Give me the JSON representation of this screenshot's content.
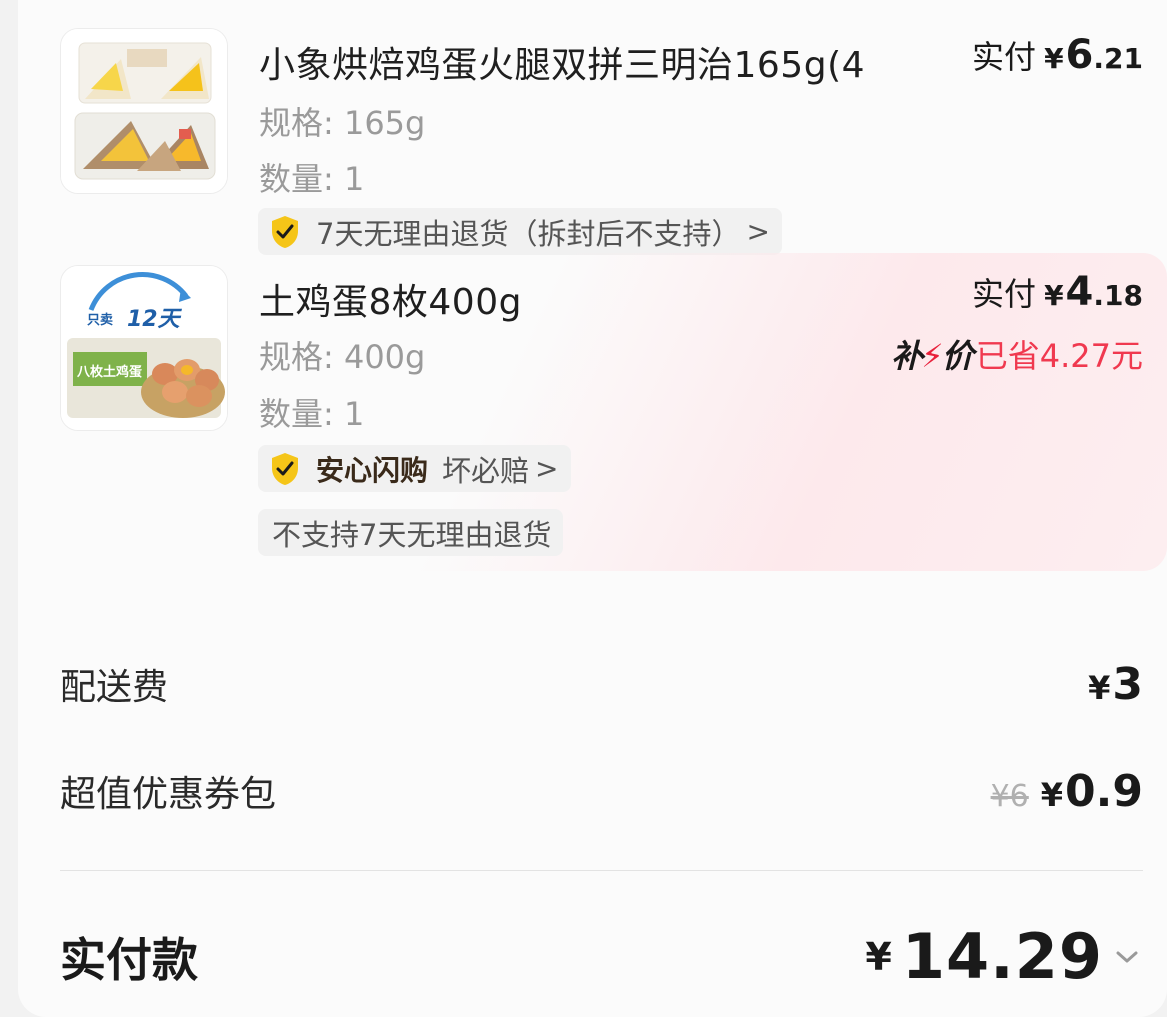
{
  "items": [
    {
      "title": "小象烘焙鸡蛋火腿双拼三明治165g(4",
      "spec": "规格: 165g",
      "qty": "数量: 1",
      "paid_label": "实付",
      "paid_yen": "¥",
      "paid_int": "6",
      "paid_dec": ".21",
      "tag1": "7天无理由退货（拆封后不支持）",
      "tag1_chevron": ">",
      "image_icon": "sandwich-product-photo"
    },
    {
      "title": "土鸡蛋8枚400g",
      "spec": "规格: 400g",
      "qty": "数量: 1",
      "paid_label": "实付",
      "paid_yen": "¥",
      "paid_int": "4",
      "paid_dec": ".18",
      "subsidy_logo_left": "补",
      "subsidy_logo_right": "价",
      "saved": "已省4.27元",
      "tag1_brand": "安心闪购",
      "tag1": "坏必赔",
      "tag1_chevron": ">",
      "tag2": "不支持7天无理由退货",
      "image_icon": "egg-product-photo",
      "image_badge_a": "只卖",
      "image_badge_b": "12天",
      "image_box_label": "八枚土鸡蛋"
    }
  ],
  "delivery": {
    "label": "配送费",
    "yen": "¥",
    "value": "3"
  },
  "coupon": {
    "label": "超值优惠券包",
    "original": "¥6",
    "yen": "¥",
    "value": "0.9"
  },
  "total": {
    "label": "实付款",
    "yen": "¥",
    "value": "14.29"
  },
  "colors": {
    "accent_red": "#f0394f",
    "shield_yellow": "#f5c518",
    "text_gray": "#9a9a9a"
  }
}
